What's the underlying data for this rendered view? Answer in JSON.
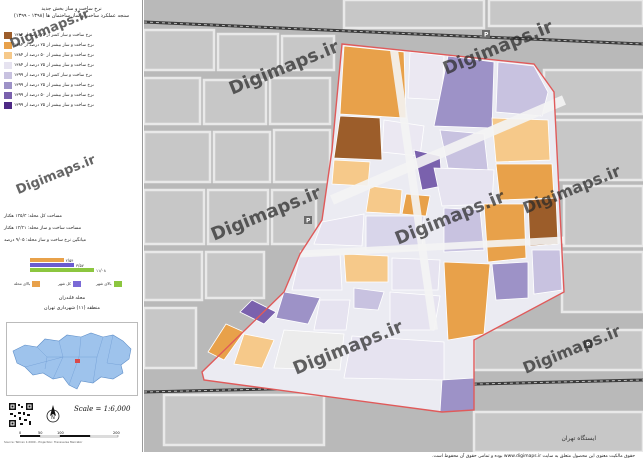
{
  "legend": {
    "title_line1": "نرخ ساخت و ساز بخش جدید",
    "title_line2": "سنجه عملکرد ساخت و ساز ساختمان ها (۱۳۹۸ - ۱۳۹۹)",
    "items": [
      {
        "label": "نرخ ساخت و ساز کمتر از ۲۵ درصد از ۱۳۸۴",
        "color": "#9c5d2a"
      },
      {
        "label": "نرخ ساخت و ساز بیشتر از ۲۵ درصد از ۱۳۸۴",
        "color": "#e8a14a"
      },
      {
        "label": "نرخ ساخت و ساز بیشتر از ۵۰ درصد از ۱۳۸۴",
        "color": "#f6c98a"
      },
      {
        "label": "نرخ ساخت و ساز بیشتر از ۷۵ درصد از ۱۳۸۴",
        "color": "#e6e3f0"
      },
      {
        "label": "نرخ ساخت و ساز کمتر از ۲۵ درصد از ۱۳۹۹",
        "color": "#c8c2e0"
      },
      {
        "label": "نرخ ساخت و ساز بیشتر از ۲۵ درصد از ۱۳۹۹",
        "color": "#9d92c7"
      },
      {
        "label": "نرخ ساخت و ساز بیشتر از ۵۰ درصد از ۱۳۹۹",
        "color": "#7a61ad"
      },
      {
        "label": "نرخ ساخت و ساز بیشتر از ۷۵ درصد از ۱۳۹۹",
        "color": "#4e2a85"
      }
    ]
  },
  "stats": {
    "line1": "مساحت کل محله: ۱۳۵/۳ هکتار",
    "line2": "مساحت ساخت و ساز محله: ۱۳/۳۱ هکتار",
    "line3": "میانگین نرخ ساخت و ساز محله: ۹/۰۵ درصد"
  },
  "bars": [
    {
      "value": "۲/۵۴",
      "fraction": 0.42,
      "color": "#e8a14a"
    },
    {
      "value": "۳/۵۷",
      "fraction": 0.55,
      "color": "#6a5bd0"
    },
    {
      "value": "۱۱/۰۸",
      "fraction": 0.8,
      "color": "#8cc63f"
    }
  ],
  "mini_legend": [
    {
      "label": "بالای شهر",
      "color": "#8cc63f"
    },
    {
      "label": "کل شهر",
      "color": "#7a6ad6"
    },
    {
      "label": "بالای محله",
      "color": "#e8a14a"
    }
  ],
  "location": {
    "line1": "محله قلندران",
    "line2": "منطقه (۱۱) شهرداری تهران"
  },
  "scale": "Scale = 1:6,000",
  "scale_labels": [
    "0",
    "50",
    "100",
    "200"
  ],
  "credit": "Source: Tehran 1:2000 - Projection: Transverse Mercator",
  "footer": "حقوق مالکیت معنوی این محصول متعلق به سایت www.digimaps.ir بوده و تمامی حقوق آن محفوظ است.",
  "watermark": "Digimaps.ir",
  "map_labels": {
    "station": "ایستگاه تهران"
  },
  "colors": {
    "boundary": "#e05a5a",
    "road": "#efefef",
    "block": "#c4c4c4",
    "rail": "#3a3a3a"
  }
}
